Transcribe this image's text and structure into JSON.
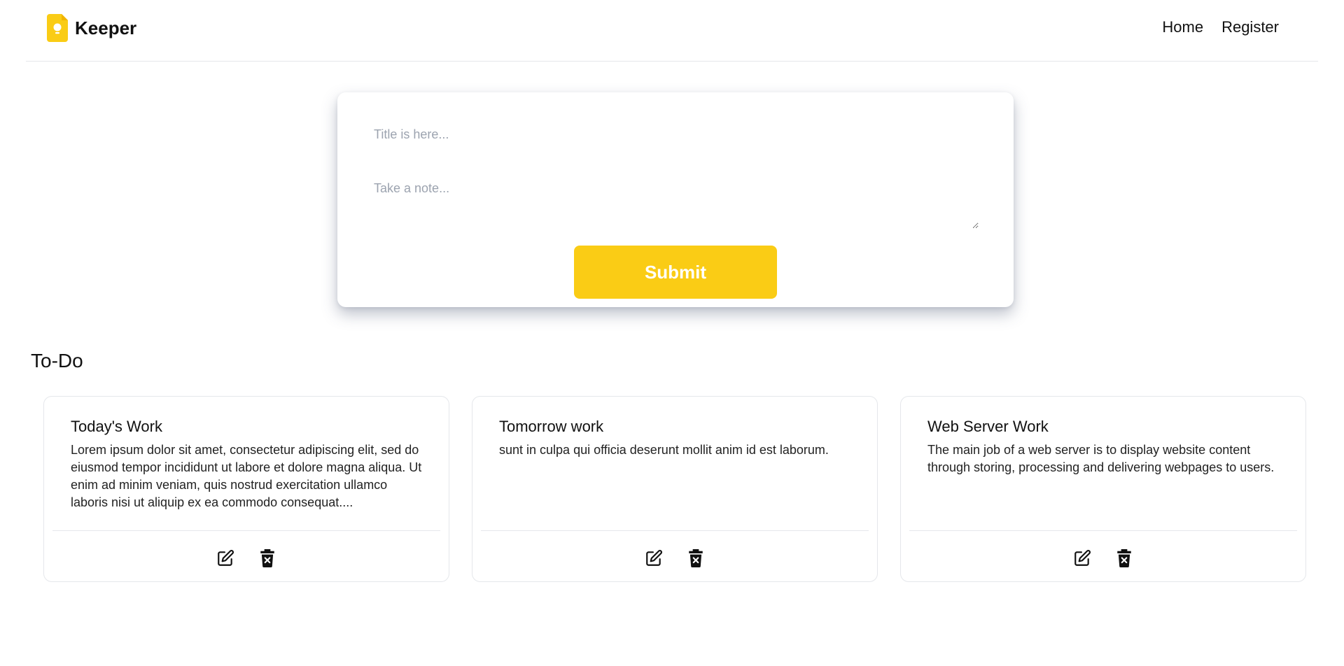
{
  "header": {
    "brand": "Keeper",
    "brand_color": "#facc15",
    "nav": [
      {
        "label": "Home",
        "icon": null
      },
      {
        "label": "Register",
        "icon": null
      }
    ]
  },
  "form": {
    "title_placeholder": "Title is here...",
    "note_placeholder": "Take a note...",
    "title_value": "",
    "note_value": "",
    "submit_label": "Submit",
    "submit_color": "#facc15"
  },
  "section": {
    "title": "To-Do"
  },
  "notes": [
    {
      "title": "Today's Work",
      "body": "Lorem ipsum dolor sit amet, consectetur adipiscing elit, sed do eiusmod tempor incididunt ut labore et dolore magna aliqua. Ut enim ad minim veniam, quis nostrud exercitation ullamco laboris nisi ut aliquip ex ea commodo consequat....",
      "actions": [
        "edit-icon",
        "trash-icon"
      ]
    },
    {
      "title": "Tomorrow work",
      "body": "sunt in culpa qui officia deserunt mollit anim id est laborum.",
      "actions": [
        "edit-icon",
        "trash-icon"
      ]
    },
    {
      "title": "Web Server Work",
      "body": "The main job of a web server is to display website content through storing, processing and delivering webpages to users.",
      "actions": [
        "edit-icon",
        "trash-icon"
      ]
    }
  ]
}
